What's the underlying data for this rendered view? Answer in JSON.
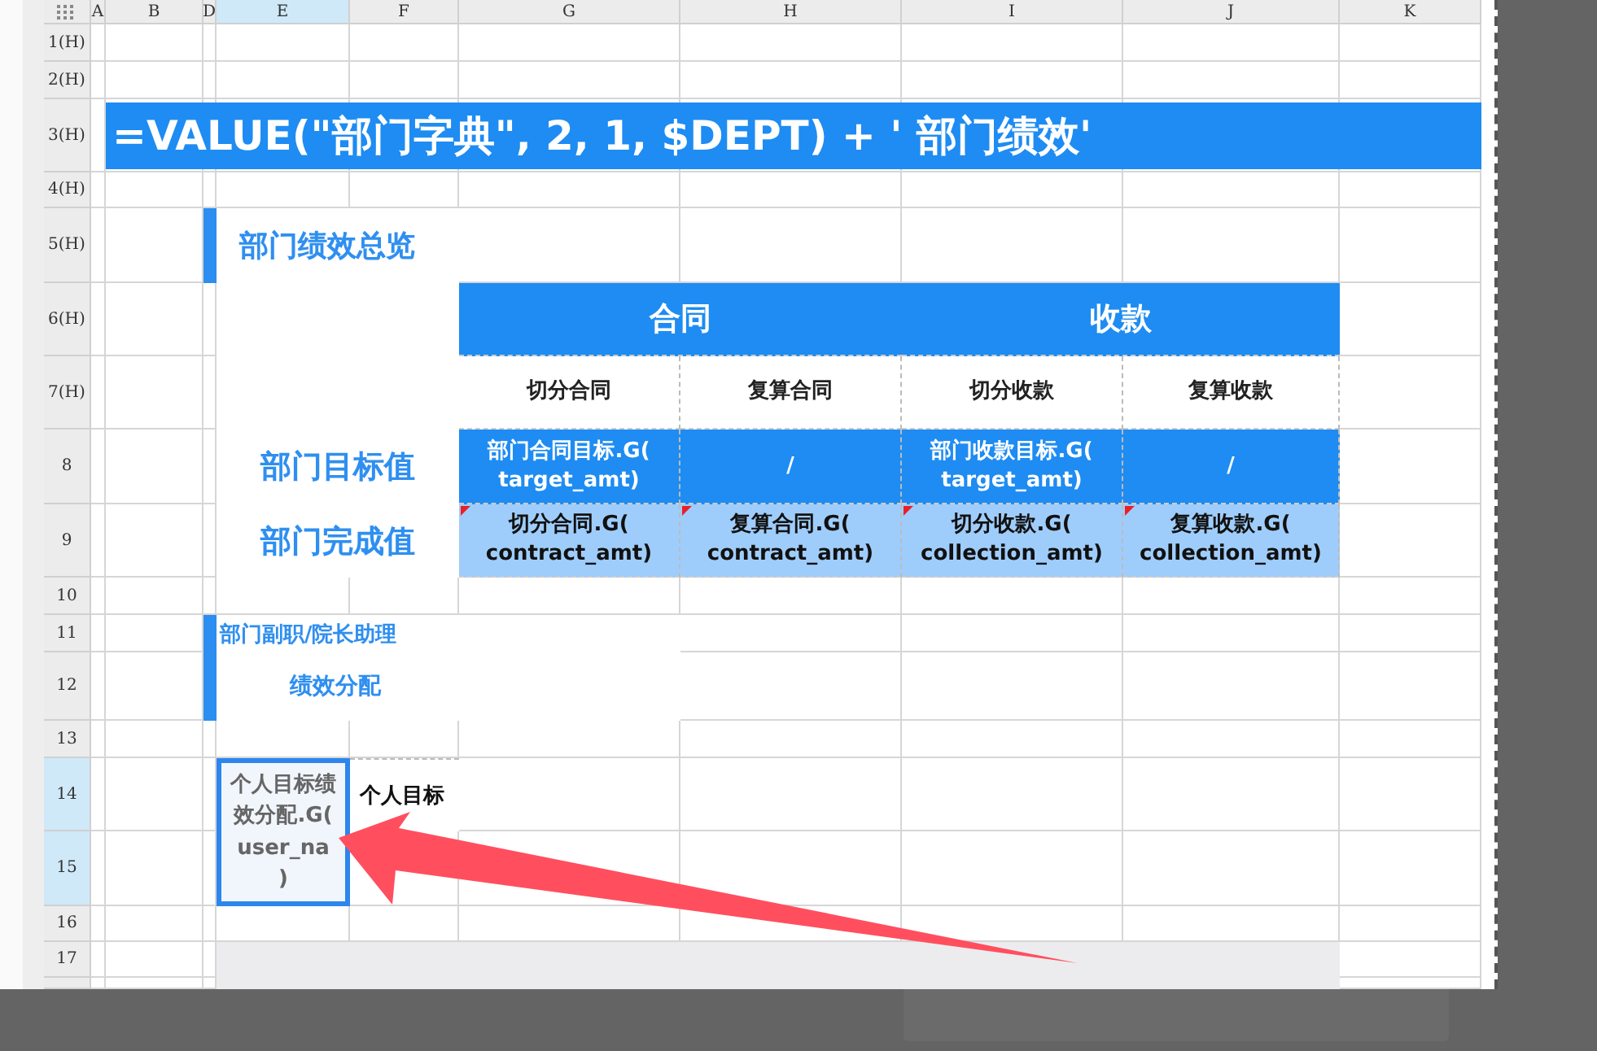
{
  "column_headers": [
    {
      "label": "A",
      "selected": false
    },
    {
      "label": "B",
      "selected": false
    },
    {
      "label": "D",
      "selected": false
    },
    {
      "label": "E",
      "selected": true
    },
    {
      "label": "F",
      "selected": false
    },
    {
      "label": "G",
      "selected": false
    },
    {
      "label": "H",
      "selected": false
    },
    {
      "label": "I",
      "selected": false
    },
    {
      "label": "J",
      "selected": false
    },
    {
      "label": "K",
      "selected": false
    }
  ],
  "row_headers": [
    {
      "label": "1(H)",
      "selected": false
    },
    {
      "label": "2(H)",
      "selected": false
    },
    {
      "label": "3(H)",
      "selected": false
    },
    {
      "label": "4(H)",
      "selected": false
    },
    {
      "label": "5(H)",
      "selected": false
    },
    {
      "label": "6(H)",
      "selected": false
    },
    {
      "label": "7(H)",
      "selected": false
    },
    {
      "label": "8",
      "selected": false
    },
    {
      "label": "9",
      "selected": false
    },
    {
      "label": "10",
      "selected": false
    },
    {
      "label": "11",
      "selected": false
    },
    {
      "label": "12",
      "selected": false
    },
    {
      "label": "13",
      "selected": false
    },
    {
      "label": "14",
      "selected": true
    },
    {
      "label": "15",
      "selected": true
    },
    {
      "label": "16",
      "selected": false
    },
    {
      "label": "17",
      "selected": false
    }
  ],
  "title_formula": "=VALUE(\"部门字典\", 2, 1, $DEPT) + ' 部门绩效'",
  "overview": {
    "heading": "部门绩效总览",
    "row_labels": [
      "部门目标值",
      "部门完成值"
    ],
    "groups": [
      {
        "label": "合同",
        "columns": [
          {
            "label": "切分合同",
            "target": "部门合同目标.G(\ntarget_amt)",
            "actual": "切分合同.G(\ncontract_amt)"
          },
          {
            "label": "复算合同",
            "target": "/",
            "actual": "复算合同.G(\ncontract_amt)"
          }
        ]
      },
      {
        "label": "收款",
        "columns": [
          {
            "label": "切分收款",
            "target": "部门收款目标.G(\ntarget_amt)",
            "actual": "切分收款.G(\ncollection_amt)"
          },
          {
            "label": "复算收款",
            "target": "/",
            "actual": "复算收款.G(\ncollection_amt)"
          }
        ]
      }
    ]
  },
  "allocation": {
    "heading": "部门副职/院长助理",
    "subheading": "绩效分配"
  },
  "selected_cell": {
    "text": "个人目标绩效分配.G(\nuser_na\n)",
    "selected": true
  },
  "adjacent_label": "个人目标"
}
